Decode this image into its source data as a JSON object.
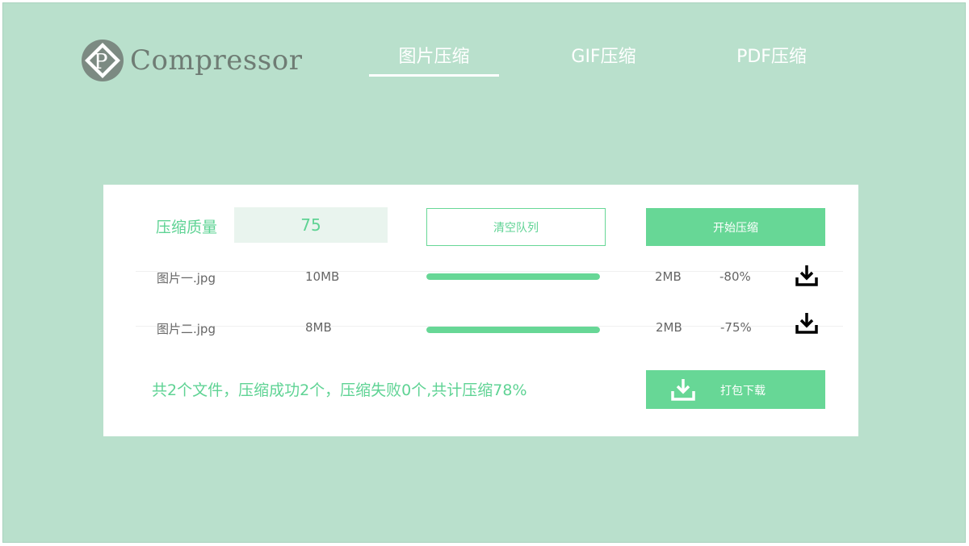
{
  "header": {
    "logo_text": "Compressor",
    "tabs": [
      {
        "label": "图片压缩",
        "active": true
      },
      {
        "label": "GIF压缩",
        "active": false
      },
      {
        "label": "PDF压缩",
        "active": false
      }
    ]
  },
  "settings": {
    "quality_label": "压缩质量",
    "quality_value": "75",
    "clear_label": "清空队列",
    "start_label": "开始压缩"
  },
  "files": [
    {
      "name": "图片一.jpg",
      "original_size": "10MB",
      "progress": 1.0,
      "compressed_size": "2MB",
      "ratio": "-80%",
      "icon": "download-icon"
    },
    {
      "name": "图片二.jpg",
      "original_size": "8MB",
      "progress": 1.0,
      "compressed_size": "2MB",
      "ratio": "-75%",
      "icon": "download-icon"
    }
  ],
  "summary": {
    "text": "共2个文件，压缩成功2个，压缩失败0个,共计压缩78%",
    "pack_label": "打包下载",
    "pack_icon": "download-icon"
  },
  "colors": {
    "background": "#b9e0cc",
    "accent": "#67d796",
    "accent_text": "#5fd394",
    "input_bg": "#e9f4ee"
  }
}
